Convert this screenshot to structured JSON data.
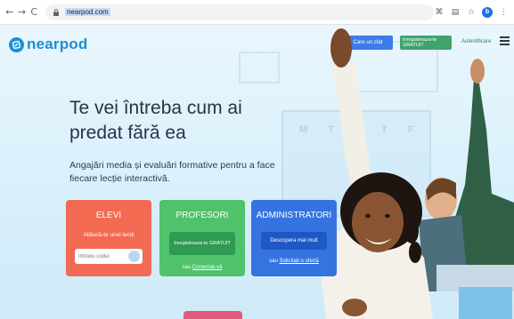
{
  "browser": {
    "nav": {
      "back": "←",
      "forward": "→",
      "reload": "C"
    },
    "url": "nearpod.com",
    "profile_initial": "b"
  },
  "header": {
    "logo_text": "nearpod",
    "join_label": "Care un cfat",
    "signup_label": "Inregistreaza-te GRATUIT",
    "login_label": "Autentificare"
  },
  "hero": {
    "title_line1": "Te vei întreba cum ai",
    "title_line2": "predat fără ea",
    "subtitle_line1": "Angajări media și evaluări formative pentru a face",
    "subtitle_line2": "fiecare lecție interactivă."
  },
  "cards": {
    "elevi": {
      "title": "ELEVI",
      "text": "Alătură-te unei lecții",
      "input_placeholder": "Introdu codul"
    },
    "profesori": {
      "title": "PROFESORI",
      "button": "Inregistreaza-te GRATUIT",
      "link_prefix": "sau ",
      "link": "Conectați-vă"
    },
    "administratori": {
      "title": "ADMINISTRATORI",
      "button": "Descopera mai mult",
      "link_prefix": "sau ",
      "link": "Solicitați o ofertă"
    }
  },
  "background_board": {
    "letters": [
      "M",
      "T",
      "T",
      "F"
    ]
  },
  "colors": {
    "brand": "#1d8fd6",
    "elevi": "#f26a52",
    "profesori": "#4fc26b",
    "administratori": "#3573e0",
    "join_button": "#3d7be8",
    "signup_button": "#3fa36b"
  }
}
